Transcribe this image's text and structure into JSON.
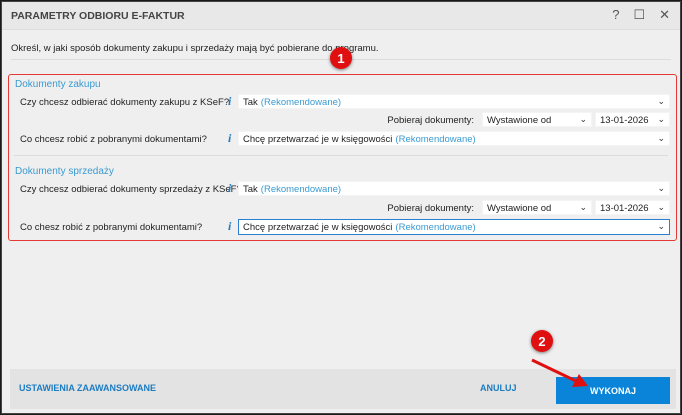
{
  "window": {
    "title": "PARAMETRY ODBIORU E-FAKTUR",
    "help": "?",
    "maximize": "☐",
    "close": "✕"
  },
  "description": "Określ, w jaki sposób dokumenty zakupu i sprzedaży mają być pobierane do programu.",
  "purchase": {
    "heading": "Dokumenty zakupu",
    "q1": "Czy chcesz odbierać dokumenty zakupu z KSeF?",
    "q1_value": "Tak",
    "q1_hint": "(Rekomendowane)",
    "fetch_label": "Pobieraj dokumenty:",
    "fetch_value": "Wystawione od",
    "date": "13-01-2026",
    "q2": "Co chcesz robić z pobranymi dokumentami?",
    "q2_value": "Chcę przetwarzać je w księgowości",
    "q2_hint": "(Rekomendowane)"
  },
  "sales": {
    "heading": "Dokumenty sprzedaży",
    "q1": "Czy chcesz odbierać dokumenty sprzedaży z KSeF?",
    "q1_value": "Tak",
    "q1_hint": "(Rekomendowane)",
    "fetch_label": "Pobieraj dokumenty:",
    "fetch_value": "Wystawione od",
    "date": "13-01-2026",
    "q2": "Co chesz robić z pobranymi dokumentami?",
    "q2_value": "Chcę przetwarzać je w księgowości",
    "q2_hint": "(Rekomendowane)"
  },
  "footer": {
    "advanced": "USTAWIENIA ZAAWANSOWANE",
    "cancel": "ANULUJ",
    "execute": "WYKONAJ"
  },
  "annotations": {
    "badge1": "1",
    "badge2": "2"
  },
  "colors": {
    "accent": "#0a84d8",
    "link": "#3a9bd2",
    "highlight": "#e53935"
  }
}
